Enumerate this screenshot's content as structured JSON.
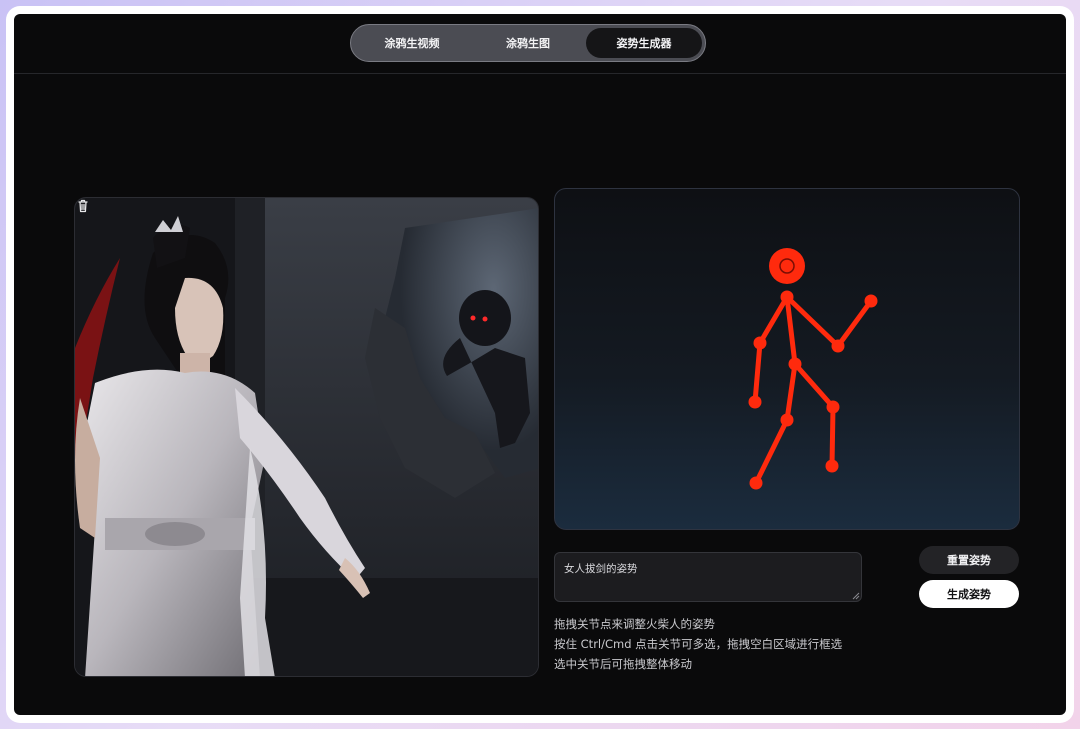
{
  "tabs": [
    {
      "label": "涂鸦生视频",
      "active": false
    },
    {
      "label": "涂鸦生图",
      "active": false
    },
    {
      "label": "姿势生成器",
      "active": true
    }
  ],
  "photo": {
    "delete_icon": "trash-icon"
  },
  "pose_editor": {
    "bone_color": "#ff2a0d",
    "background_top": "#0e1014",
    "background_bottom": "#1b2c3e"
  },
  "prompt": {
    "value": "女人拔剑的姿势"
  },
  "actions": {
    "reset_label": "重置姿势",
    "generate_label": "生成姿势"
  },
  "hints": {
    "line1": "拖拽关节点来调整火柴人的姿势",
    "line2": "按住 Ctrl/Cmd 点击关节可多选，拖拽空白区域进行框选",
    "line3": "选中关节后可拖拽整体移动"
  },
  "colors": {
    "app_background": "#0a0a0b",
    "tab_bar": "#4b4c53",
    "active_tab": "#151517",
    "primary_button": "#ffffff"
  }
}
